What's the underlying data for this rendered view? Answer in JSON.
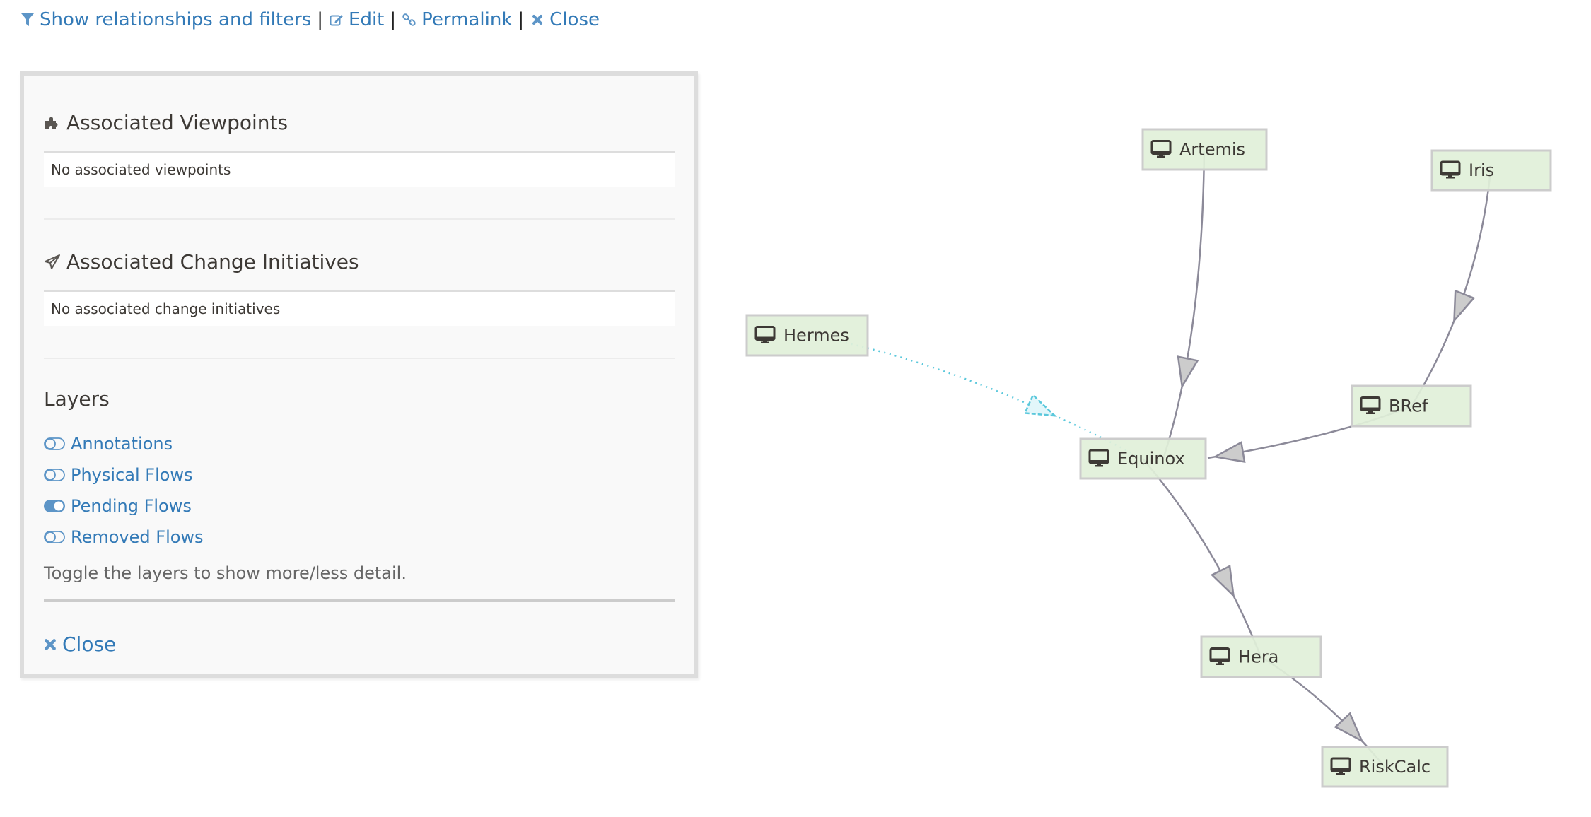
{
  "toolbar": {
    "items": [
      {
        "label": "Show relationships and filters",
        "icon": "filter-icon"
      },
      {
        "label": "Edit",
        "icon": "edit-icon"
      },
      {
        "label": "Permalink",
        "icon": "link-icon"
      },
      {
        "label": "Close",
        "icon": "close-icon"
      }
    ],
    "separator": "|"
  },
  "panel": {
    "viewpoints": {
      "title": "Associated Viewpoints",
      "icon": "puzzle-icon",
      "empty_text": "No associated viewpoints"
    },
    "change_initiatives": {
      "title": "Associated Change Initiatives",
      "icon": "paper-plane-icon",
      "empty_text": "No associated change initiatives"
    },
    "layers": {
      "title": "Layers",
      "items": [
        {
          "label": "Annotations",
          "enabled": false
        },
        {
          "label": "Physical Flows",
          "enabled": false
        },
        {
          "label": "Pending Flows",
          "enabled": true
        },
        {
          "label": "Removed Flows",
          "enabled": false
        }
      ],
      "hint": "Toggle the layers to show more/less detail."
    },
    "close_label": "Close"
  },
  "diagram": {
    "colors": {
      "node_fill": "#e1f0d9",
      "node_stroke": "#cccccc",
      "edge": "#8c8a99",
      "arrow_fill": "#cccccc",
      "pending_edge": "#5bc8dc",
      "pending_arrow_fill": "#e2f6fa",
      "link": "#337ab7"
    },
    "nodes": [
      {
        "id": "artemis",
        "label": "Artemis",
        "icon": "desktop-icon"
      },
      {
        "id": "iris",
        "label": "Iris",
        "icon": "desktop-icon"
      },
      {
        "id": "hermes",
        "label": "Hermes",
        "icon": "desktop-icon"
      },
      {
        "id": "bref",
        "label": "BRef",
        "icon": "desktop-icon"
      },
      {
        "id": "equinox",
        "label": "Equinox",
        "icon": "desktop-icon"
      },
      {
        "id": "hera",
        "label": "Hera",
        "icon": "desktop-icon"
      },
      {
        "id": "riskcalc",
        "label": "RiskCalc",
        "icon": "desktop-icon"
      }
    ],
    "edges": [
      {
        "from": "artemis",
        "to": "equinox",
        "status": "active"
      },
      {
        "from": "iris",
        "to": "bref",
        "status": "active"
      },
      {
        "from": "bref",
        "to": "equinox",
        "status": "active"
      },
      {
        "from": "equinox",
        "to": "hera",
        "status": "active"
      },
      {
        "from": "hera",
        "to": "riskcalc",
        "status": "active"
      },
      {
        "from": "hermes",
        "to": "equinox",
        "status": "pending"
      }
    ]
  }
}
